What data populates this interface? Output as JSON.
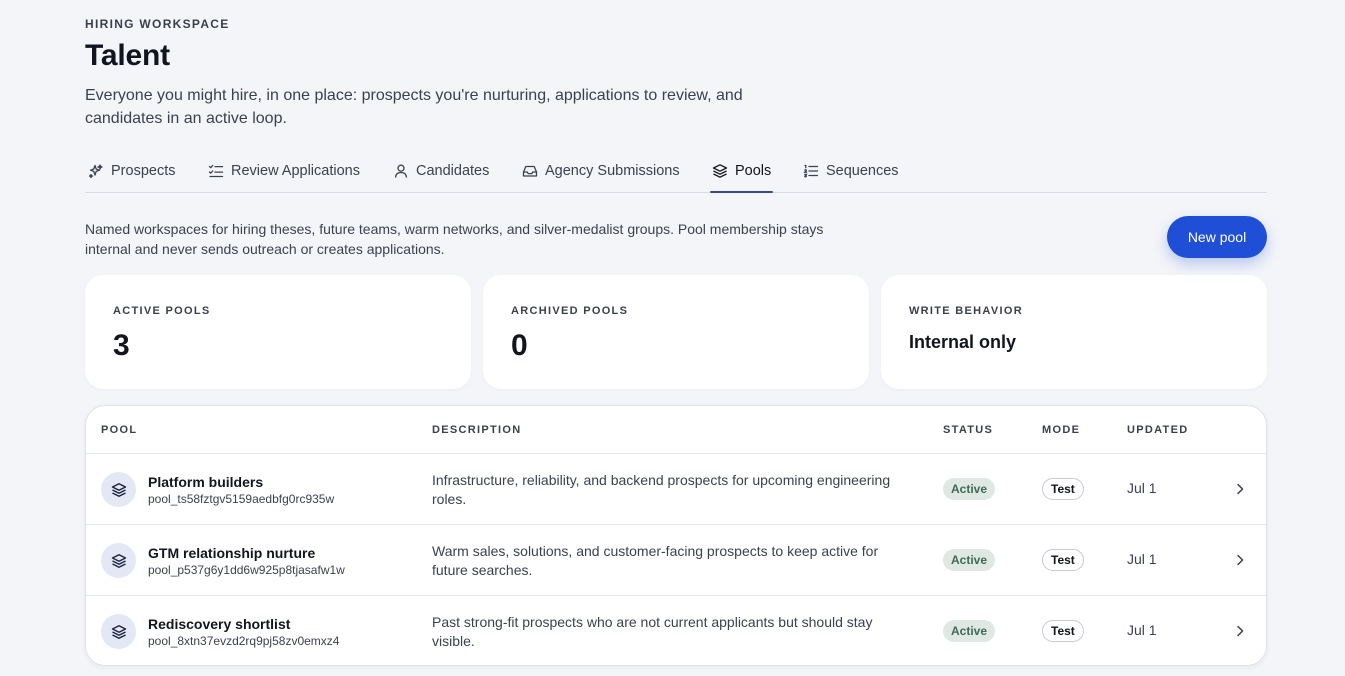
{
  "header": {
    "eyebrow": "HIRING WORKSPACE",
    "title": "Talent",
    "subtitle": "Everyone you might hire, in one place: prospects you're nurturing, applications to review, and candidates in an active loop."
  },
  "tabs": [
    {
      "label": "Prospects",
      "icon": "sparkles-icon"
    },
    {
      "label": "Review Applications",
      "icon": "checklist-icon"
    },
    {
      "label": "Candidates",
      "icon": "user-icon"
    },
    {
      "label": "Agency Submissions",
      "icon": "inbox-icon"
    },
    {
      "label": "Pools",
      "icon": "layers-icon",
      "active": true
    },
    {
      "label": "Sequences",
      "icon": "list-ordered-icon"
    }
  ],
  "pools_section": {
    "description": "Named workspaces for hiring theses, future teams, warm networks, and silver-medalist groups. Pool membership stays internal and never sends outreach or creates applications.",
    "new_pool_label": "New pool"
  },
  "stats": [
    {
      "label": "ACTIVE POOLS",
      "value": "3"
    },
    {
      "label": "ARCHIVED POOLS",
      "value": "0"
    },
    {
      "label": "WRITE BEHAVIOR",
      "value": "Internal only"
    }
  ],
  "table": {
    "columns": {
      "pool": "POOL",
      "description": "DESCRIPTION",
      "status": "STATUS",
      "mode": "MODE",
      "updated": "UPDATED"
    },
    "rows": [
      {
        "name": "Platform builders",
        "id": "pool_ts58fztgv5159aedbfg0rc935w",
        "description": "Infrastructure, reliability, and backend prospects for upcoming engineering roles.",
        "status": "Active",
        "mode": "Test",
        "updated": "Jul 1"
      },
      {
        "name": "GTM relationship nurture",
        "id": "pool_p537g6y1dd6w925p8tjasafw1w",
        "description": "Warm sales, solutions, and customer-facing prospects to keep active for future searches.",
        "status": "Active",
        "mode": "Test",
        "updated": "Jul 1"
      },
      {
        "name": "Rediscovery shortlist",
        "id": "pool_8xtn37evzd2rq9pj58zv0emxz4",
        "description": "Past strong-fit prospects who are not current applicants but should stay visible.",
        "status": "Active",
        "mode": "Test",
        "updated": "Jul 1"
      }
    ]
  },
  "colors": {
    "accent": "#1f4fd6",
    "tab_underline": "#3b4a8a",
    "status_active_bg": "#dfe8e3",
    "status_active_text": "#3f6a57",
    "background": "#f4f5f8"
  }
}
